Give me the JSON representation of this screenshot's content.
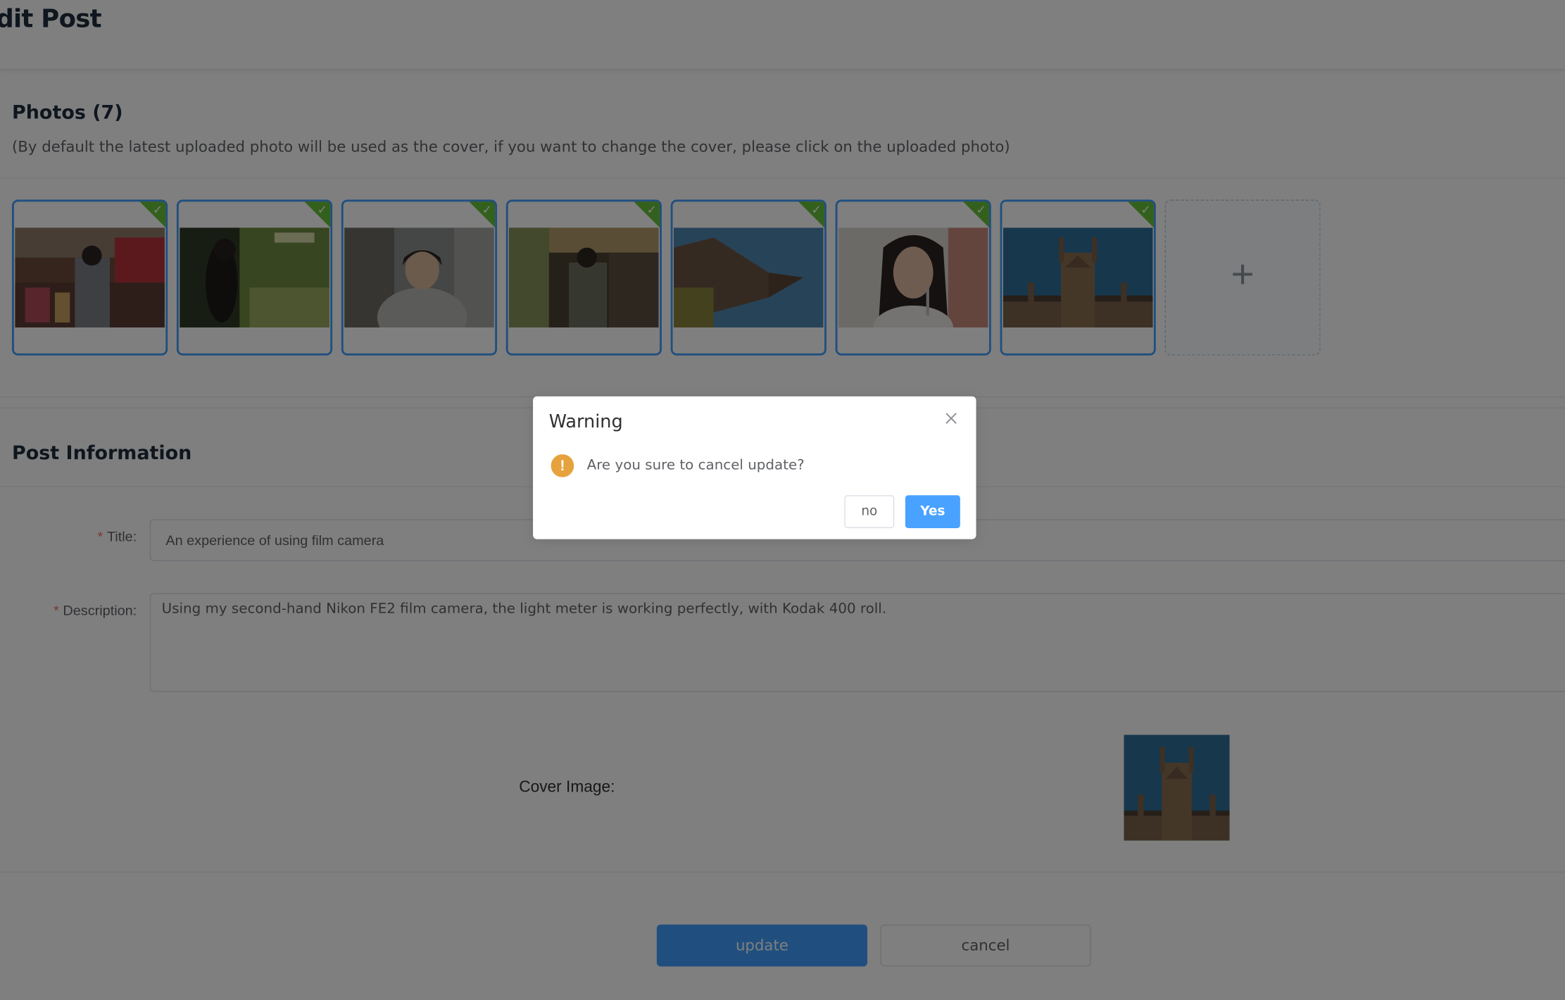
{
  "header": {
    "title": "dit Post"
  },
  "photos": {
    "title": "Photos (7)",
    "hint": "(By default the latest uploaded photo will be used as the cover, if you want to change the cover, please click on the uploaded photo)",
    "count": 7,
    "upload_icon": "plus-icon",
    "selected_color": "#409eff",
    "check_color": "#67c23a"
  },
  "post_info": {
    "title": "Post Information",
    "title_label": "Title:",
    "title_value": "An experience of using film camera",
    "description_label": "Description:",
    "description_value": "Using my second-hand Nikon FE2 film camera, the light meter is working perfectly, with Kodak 400 roll.",
    "required_mark": "*",
    "cover_label": "Cover Image:"
  },
  "actions": {
    "update_label": "update",
    "cancel_label": "cancel"
  },
  "dialog": {
    "title": "Warning",
    "message": "Are you sure to cancel update?",
    "icon": "warning-icon",
    "icon_glyph": "!",
    "no_label": "no",
    "yes_label": "Yes",
    "close_icon": "close-icon"
  }
}
